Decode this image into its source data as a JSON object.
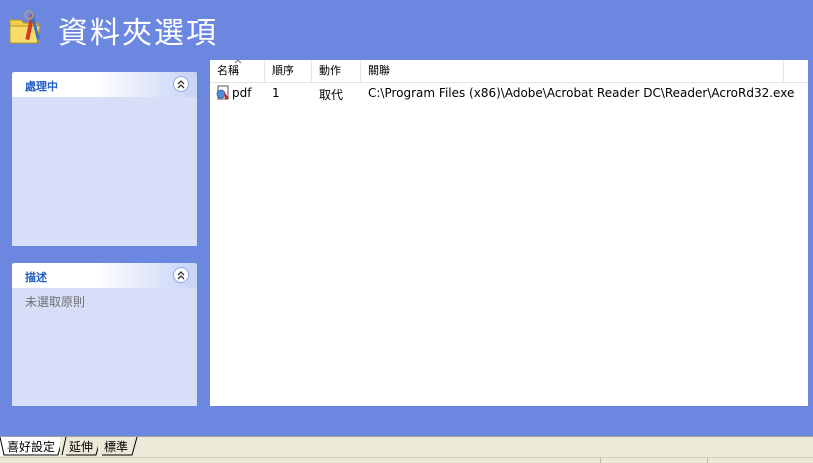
{
  "header": {
    "title": "資料夾選項",
    "icon": "folder-tools-icon"
  },
  "panels": {
    "processing": {
      "title": "處理中",
      "body": ""
    },
    "description": {
      "title": "描述",
      "body": "未選取原則"
    }
  },
  "listview": {
    "columns": [
      "名稱",
      "順序",
      "動作",
      "關聯"
    ],
    "rows": [
      {
        "name": "pdf",
        "order": "1",
        "action": "取代",
        "association": "C:\\Program Files (x86)\\Adobe\\Acrobat Reader DC\\Reader\\AcroRd32.exe"
      }
    ]
  },
  "tabs": [
    "喜好設定",
    "延伸",
    "標準"
  ],
  "colors": {
    "background": "#6b87e0",
    "panel": "#d6dff7",
    "panel_title": "#215dc6"
  }
}
